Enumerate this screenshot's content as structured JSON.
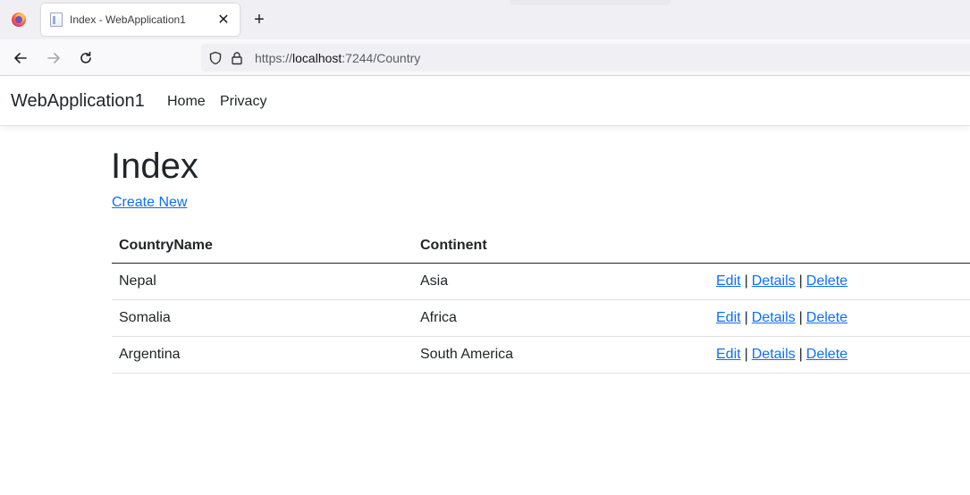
{
  "browser": {
    "tab_title": "Index - WebApplication1",
    "tab_close": "✕",
    "new_tab": "+",
    "url_prefix": "https://",
    "url_host": "localhost",
    "url_rest": ":7244/Country"
  },
  "app": {
    "brand": "WebApplication1",
    "nav": [
      "Home",
      "Privacy"
    ]
  },
  "page": {
    "title": "Index",
    "create_link": "Create New"
  },
  "table": {
    "headers": [
      "CountryName",
      "Continent",
      ""
    ],
    "rows": [
      {
        "country": "Nepal",
        "continent": "Asia"
      },
      {
        "country": "Somalia",
        "continent": "Africa"
      },
      {
        "country": "Argentina",
        "continent": "South America"
      }
    ],
    "actions": {
      "edit": "Edit",
      "details": "Details",
      "delete": "Delete",
      "separator": "|"
    }
  },
  "colors": {
    "link": "#0d6efd",
    "text": "#212529"
  }
}
